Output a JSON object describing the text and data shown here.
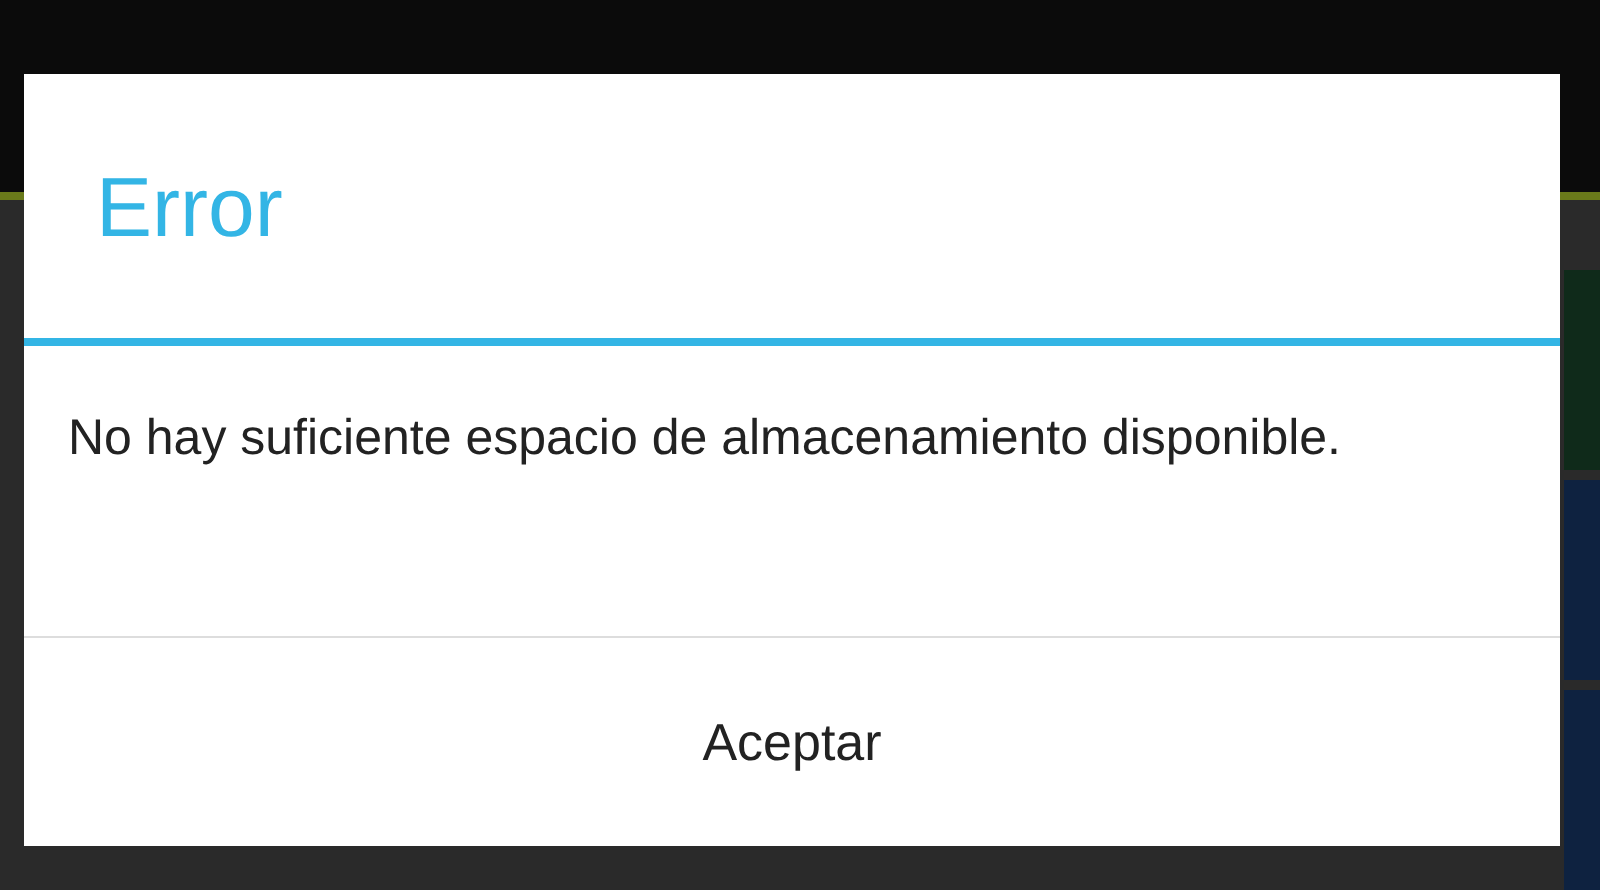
{
  "dialog": {
    "title": "Error",
    "message": "No hay suficiente espacio de almacenamiento disponible.",
    "buttons": [
      "Aceptar"
    ]
  }
}
